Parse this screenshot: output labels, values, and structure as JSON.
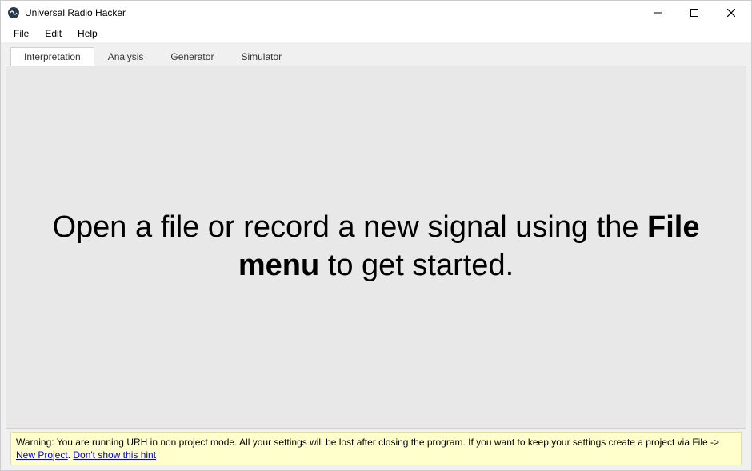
{
  "window": {
    "title": "Universal Radio Hacker"
  },
  "menubar": {
    "items": [
      "File",
      "Edit",
      "Help"
    ]
  },
  "tabs": {
    "items": [
      "Interpretation",
      "Analysis",
      "Generator",
      "Simulator"
    ],
    "active_index": 0
  },
  "welcome": {
    "before": "Open a file or record a new signal using the ",
    "bold": "File menu",
    "after": " to get started."
  },
  "warning": {
    "prefix": "Warning: You are running URH in non project mode. All your settings will be lost after closing the program. If you want to keep your settings create a project via File -> ",
    "link1": "New Project",
    "sep": ". ",
    "link2": "Don't show this hint"
  }
}
